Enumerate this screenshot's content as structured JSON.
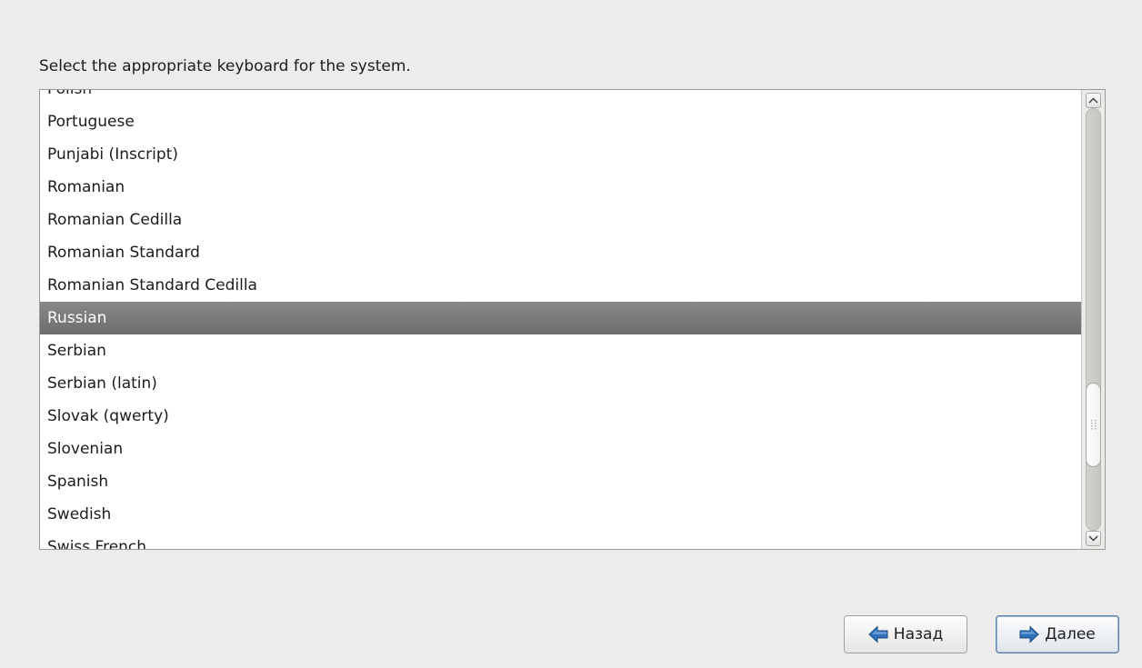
{
  "prompt": {
    "text": "Select the appropriate keyboard for the system."
  },
  "keyboard_list": {
    "items": [
      "Polish",
      "Portuguese",
      "Punjabi (Inscript)",
      "Romanian",
      "Romanian Cedilla",
      "Romanian Standard",
      "Romanian Standard Cedilla",
      "Russian",
      "Serbian",
      "Serbian (latin)",
      "Slovak (qwerty)",
      "Slovenian",
      "Spanish",
      "Swedish",
      "Swiss French"
    ],
    "selected": "Russian"
  },
  "icons": {
    "scroll_up": "chevron-up-icon",
    "scroll_down": "chevron-down-icon",
    "back": "arrow-left-icon",
    "next": "arrow-right-icon"
  },
  "colors": {
    "selection": "#7c7a78",
    "arrow_blue": "#2f6fb5",
    "default_button_border": "#5b7fae"
  },
  "buttons": {
    "back_label": "Назад",
    "next_label": "Далее"
  }
}
